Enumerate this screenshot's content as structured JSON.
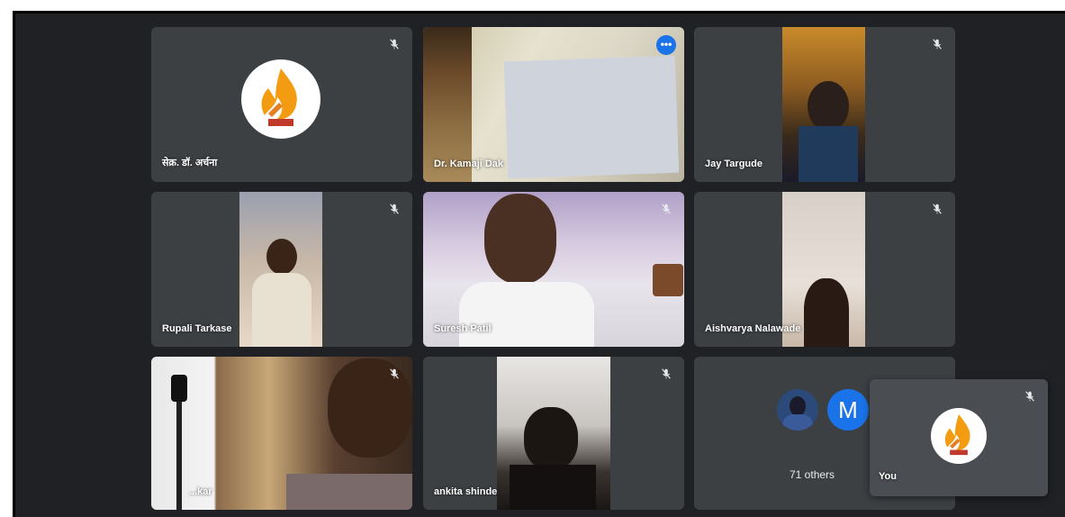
{
  "participants": [
    {
      "name": "सेक्र. डॉ. अर्चना",
      "muted": true,
      "type": "logo"
    },
    {
      "name": "Dr. Kamaji Dak",
      "muted": false,
      "type": "video",
      "active": true
    },
    {
      "name": "Jay Targude",
      "muted": true,
      "type": "video"
    },
    {
      "name": "Rupali Tarkase",
      "muted": true,
      "type": "video"
    },
    {
      "name": "Suresh Patil",
      "muted": true,
      "type": "video"
    },
    {
      "name": "Aishvarya Nalawade",
      "muted": true,
      "type": "video"
    },
    {
      "name": "...kar",
      "muted": true,
      "type": "video"
    },
    {
      "name": "ankita shinde",
      "muted": true,
      "type": "video"
    }
  ],
  "others_tile": {
    "avatar_letter": "M",
    "label": "71 others"
  },
  "self_tile": {
    "name": "You",
    "muted": true
  },
  "more_options_glyph": "•••",
  "colors": {
    "background": "#202124",
    "tile": "#3c4043",
    "active_border": "#8ab4f8",
    "avatar_blue": "#1a73e8"
  }
}
